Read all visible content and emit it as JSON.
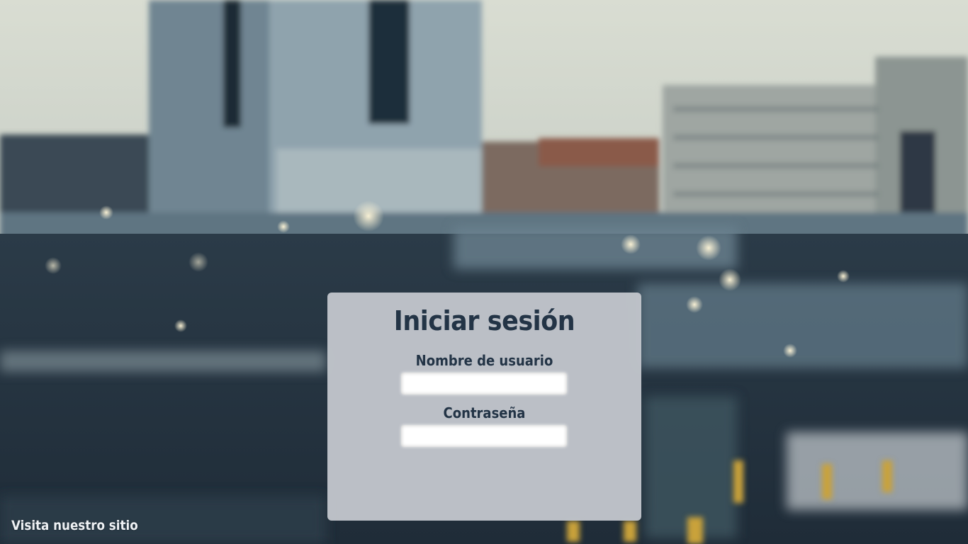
{
  "login": {
    "title": "Iniciar sesión",
    "username_label": "Nombre de usuario",
    "username_value": "",
    "password_label": "Contraseña",
    "password_value": ""
  },
  "footer": {
    "site_link": "Visita nuestro sitio"
  },
  "colors": {
    "panel_bg": "#c0c4ca",
    "text_dark": "#233446",
    "link_text": "#eef1f4"
  }
}
